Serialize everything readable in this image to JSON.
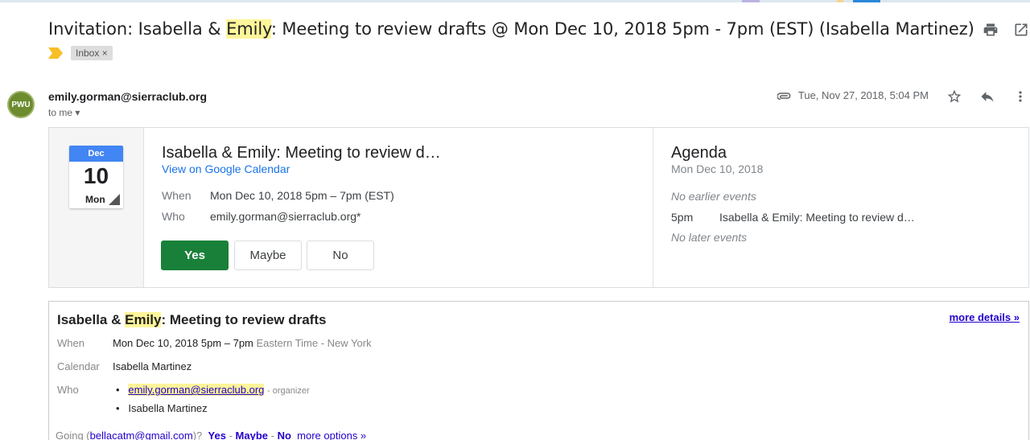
{
  "email": {
    "subject_prefix": "Invitation: Isabella & ",
    "subject_highlight": "Emily",
    "subject_suffix": ": Meeting to review drafts @ Mon Dec 10, 2018 5pm - 7pm (EST) (Isabella Martinez)",
    "label_chip": "Inbox ×",
    "sender": "emily.gorman@sierraclub.org",
    "to_me": "to me ▾",
    "timestamp": "Tue, Nov 27, 2018, 5:04 PM",
    "avatar_text": "PWU"
  },
  "event_card": {
    "cal_month": "Dec",
    "cal_day": "10",
    "cal_dow": "Mon",
    "title": "Isabella & Emily: Meeting to review d…",
    "view_link": "View on Google Calendar",
    "when_label": "When",
    "when_value": "Mon Dec 10, 2018 5pm – 7pm (EST)",
    "who_label": "Who",
    "who_value": "emily.gorman@sierraclub.org*",
    "btn_yes": "Yes",
    "btn_maybe": "Maybe",
    "btn_no": "No"
  },
  "agenda": {
    "title": "Agenda",
    "date": "Mon Dec 10, 2018",
    "no_earlier": "No earlier events",
    "time": "5pm",
    "event": "Isabella & Emily: Meeting to review d…",
    "no_later": "No later events"
  },
  "invite": {
    "title_prefix": "Isabella & ",
    "title_highlight": "Emily",
    "title_suffix": ": Meeting to review drafts",
    "more_details": "more details »",
    "when_label": "When",
    "when_value": "Mon Dec 10, 2018 5pm – 7pm",
    "when_tz": "Eastern Time - New York",
    "calendar_label": "Calendar",
    "calendar_value": "Isabella Martinez",
    "who_label": "Who",
    "who_1": "emily.gorman@sierraclub.org",
    "who_1_role": "- organizer",
    "who_2": "Isabella Martinez",
    "going_prefix": "Going (",
    "going_email": "bellacatm@gmail.com",
    "going_suffix": ")?",
    "going_yes": "Yes",
    "going_maybe": "Maybe",
    "going_no": "No",
    "going_sep": "-",
    "more_options": "more options »"
  },
  "colors": {
    "accent_green": "#188038",
    "link_blue": "#1a73e8",
    "highlight": "#fdf59a"
  }
}
